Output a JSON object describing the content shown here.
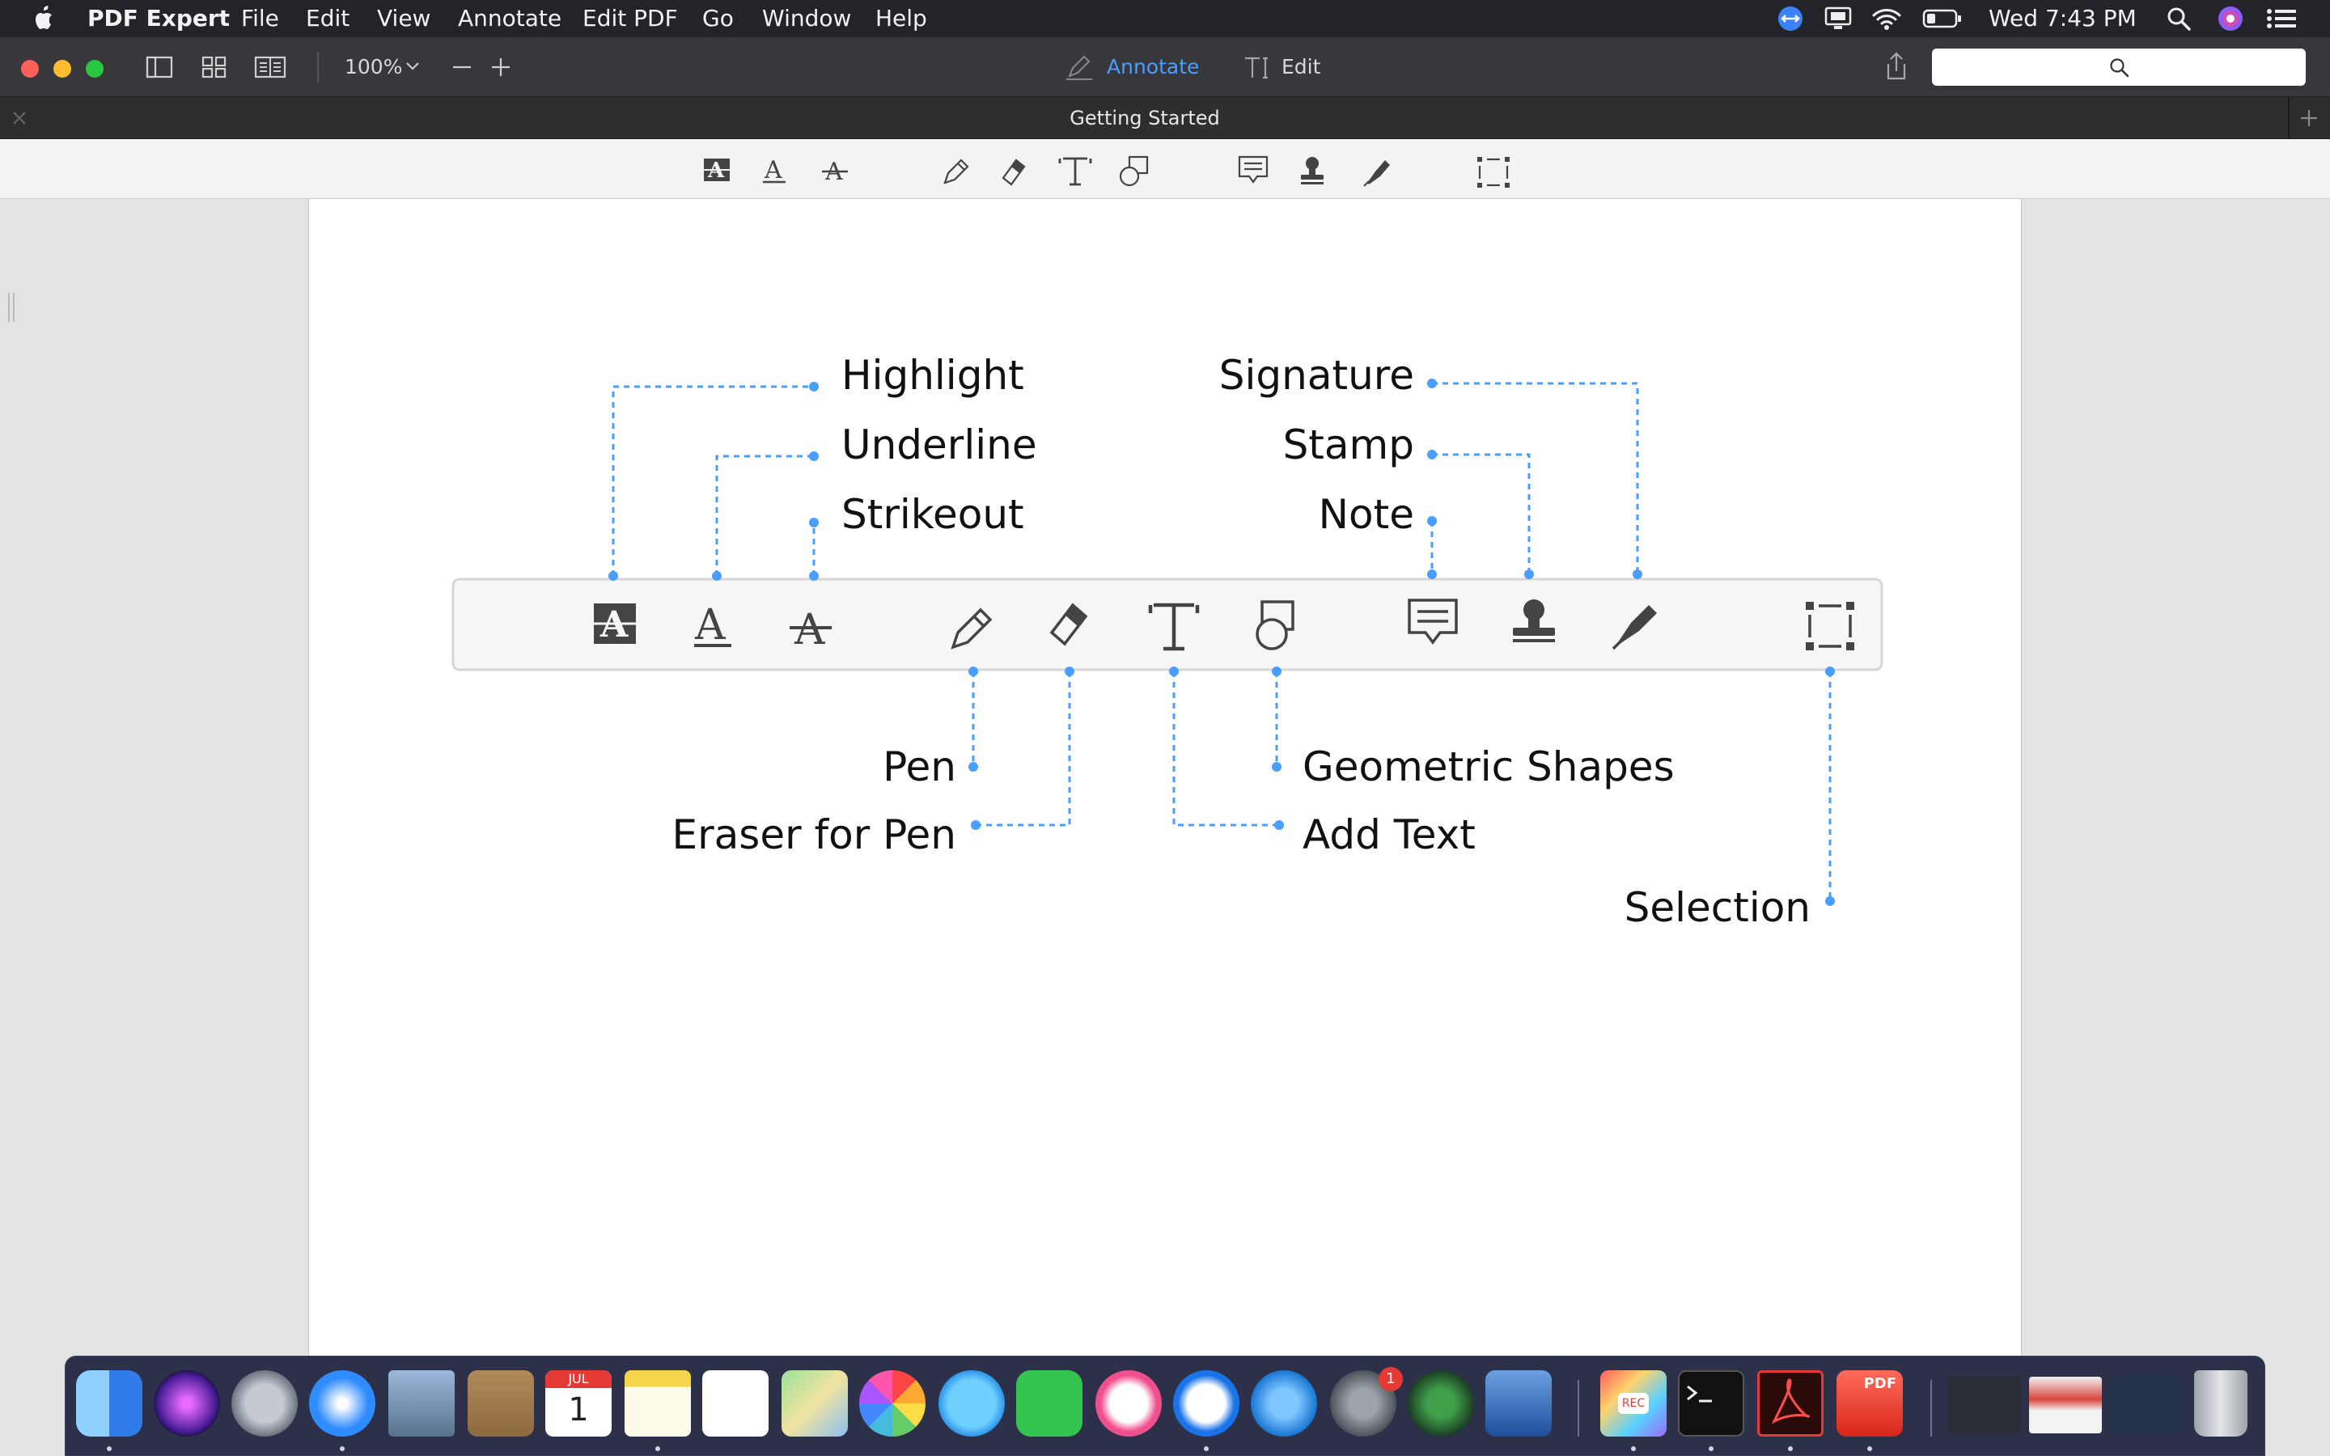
{
  "menubar": {
    "app_name": "PDF Expert",
    "items": [
      "File",
      "Edit",
      "View",
      "Annotate",
      "Edit PDF",
      "Go",
      "Window",
      "Help"
    ],
    "clock": "Wed 7:43 PM"
  },
  "toolbar": {
    "zoom": "100%",
    "annotate_label": "Annotate",
    "edit_label": "Edit",
    "search_placeholder": "",
    "accent_color": "#4a9eff"
  },
  "tab": {
    "title": "Getting Started"
  },
  "labels": {
    "highlight": "Highlight",
    "underline": "Underline",
    "strikeout": "Strikeout",
    "signature": "Signature",
    "stamp": "Stamp",
    "note": "Note",
    "pen": "Pen",
    "eraser": "Eraser for Pen",
    "geometric": "Geometric Shapes",
    "addtext": "Add Text",
    "selection": "Selection"
  },
  "annotation_tools": [
    "highlight-icon",
    "underline-icon",
    "strikeout-icon",
    "pen-icon",
    "eraser-icon",
    "add-text-icon",
    "shapes-icon",
    "note-icon",
    "stamp-icon",
    "signature-icon",
    "selection-icon"
  ],
  "dock": {
    "calendar_month": "JUL",
    "calendar_day": "1",
    "appstore_badge": "1",
    "recorder_label": "REC",
    "pdf_label": "PDF"
  }
}
